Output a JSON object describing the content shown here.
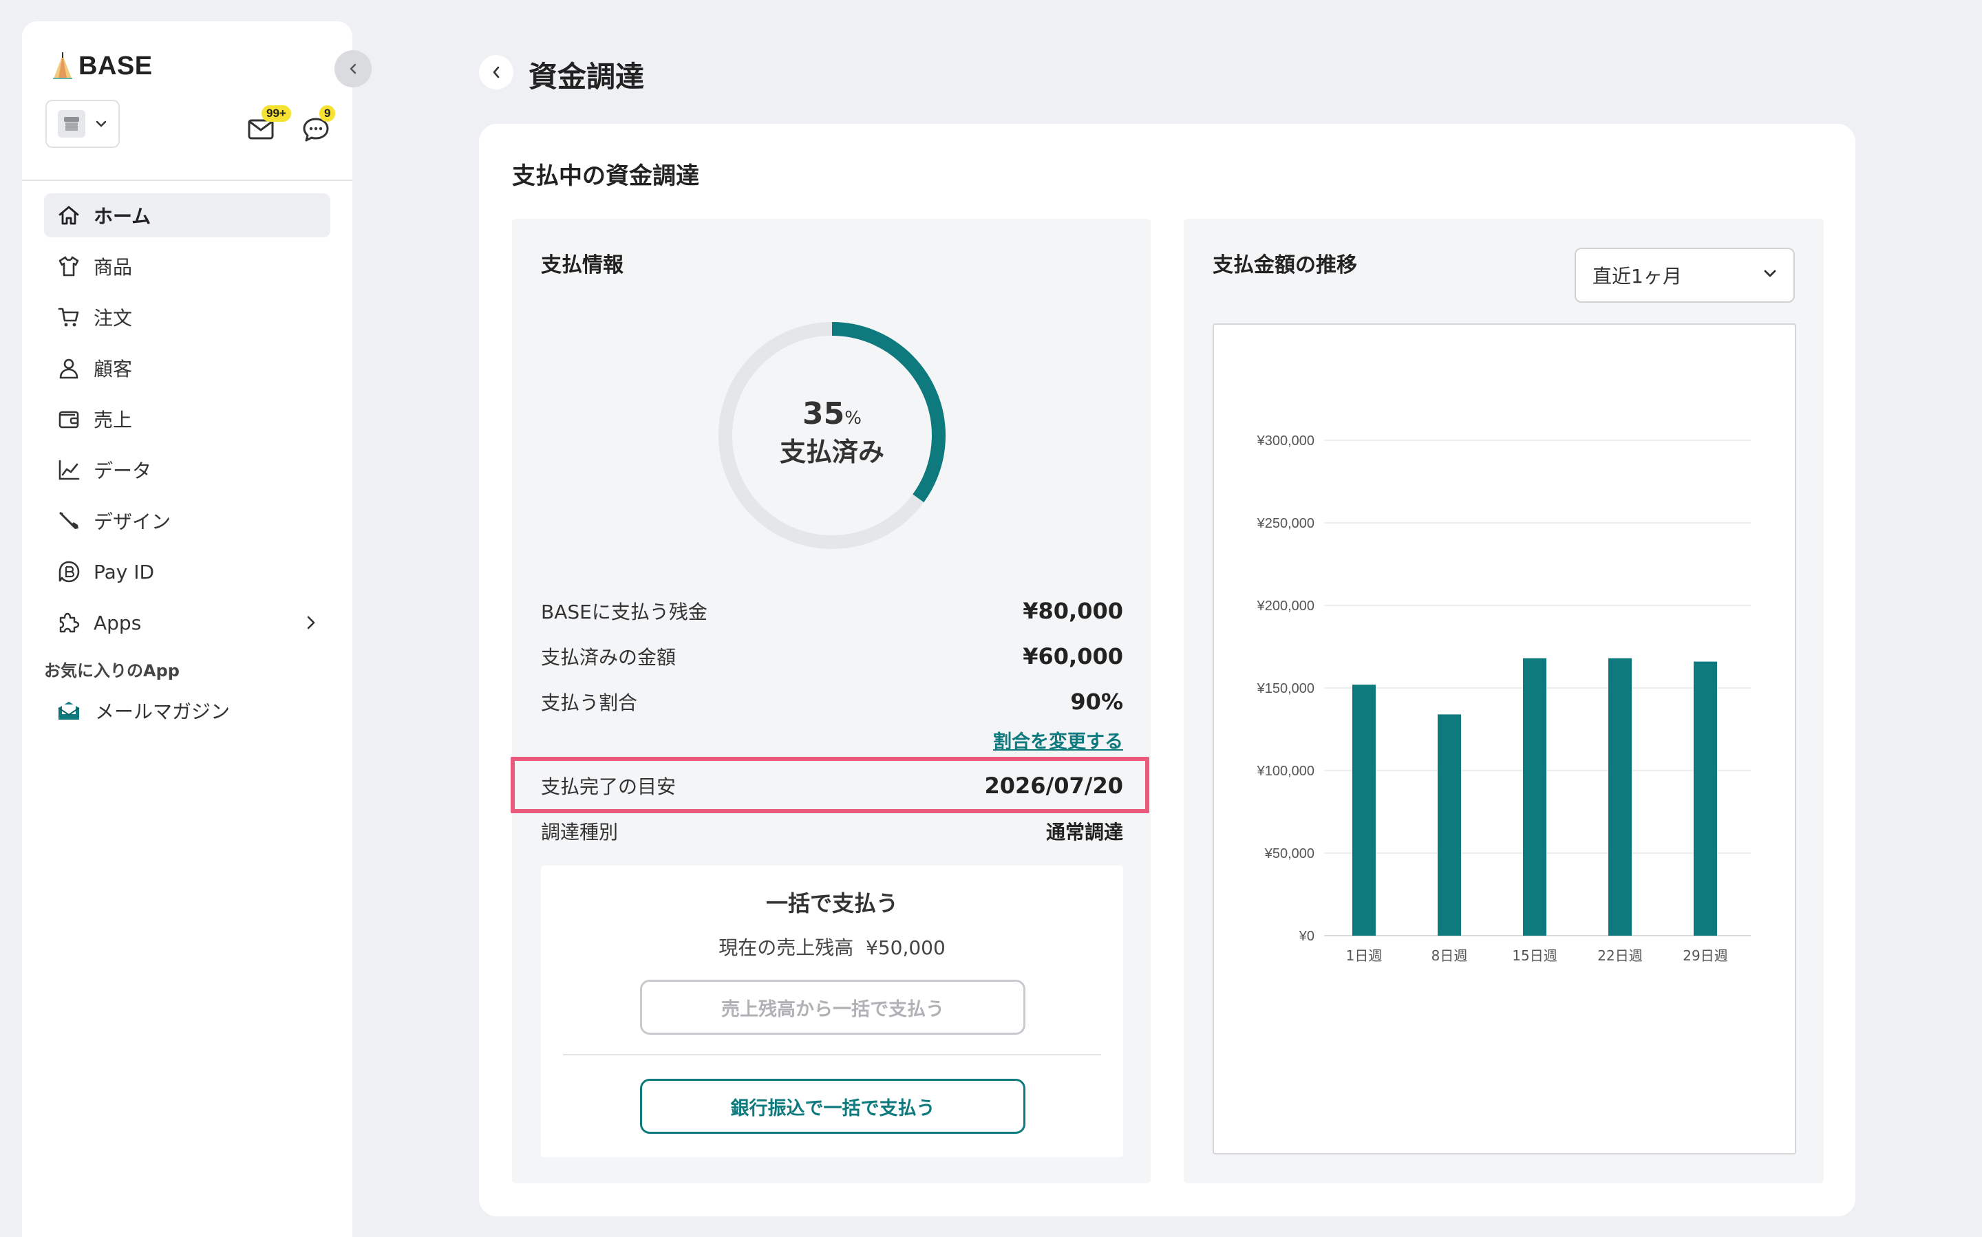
{
  "sidebar": {
    "brand": "BASE",
    "badges": {
      "mail": "99+",
      "chat": "9"
    },
    "items": [
      {
        "label": "ホーム",
        "icon": "home-icon"
      },
      {
        "label": "商品",
        "icon": "shirt-icon"
      },
      {
        "label": "注文",
        "icon": "cart-icon"
      },
      {
        "label": "顧客",
        "icon": "person-icon"
      },
      {
        "label": "売上",
        "icon": "wallet-icon"
      },
      {
        "label": "データ",
        "icon": "chart-line-icon"
      },
      {
        "label": "デザイン",
        "icon": "brush-icon"
      },
      {
        "label": "Pay ID",
        "icon": "pay-id-icon"
      },
      {
        "label": "Apps",
        "icon": "puzzle-icon"
      }
    ],
    "favorites_title": "お気に入りのApp",
    "favorites": [
      {
        "label": "メールマガジン",
        "icon": "mail-magazine-icon"
      }
    ]
  },
  "header": {
    "title": "資金調達"
  },
  "main": {
    "card_title": "支払中の資金調達",
    "payment_info": {
      "title": "支払情報",
      "progress_percent": 35,
      "progress_value": "35",
      "progress_unit": "%",
      "progress_label": "支払済み",
      "rows": [
        {
          "key": "BASEに支払う残金",
          "value": "¥80,000"
        },
        {
          "key": "支払済みの金額",
          "value": "¥60,000"
        },
        {
          "key": "支払う割合",
          "value": "90%"
        }
      ],
      "change_ratio_link": "割合を変更する",
      "completion_key": "支払完了の目安",
      "completion_value": "2026/07/20",
      "type_key": "調達種別",
      "type_value": "通常調達"
    },
    "lump_sum": {
      "title": "一括で支払う",
      "balance_label": "現在の売上残高",
      "balance_value": "¥50,000",
      "from_balance_button": "売上残高から一括で支払う",
      "bank_button": "銀行振込で一括で支払う"
    },
    "trend": {
      "title": "支払金額の推移",
      "range_selected": "直近1ヶ月"
    }
  },
  "colors": {
    "accent": "#0f7a7e",
    "highlight": "#ea5a7c",
    "badge": "#f5e233"
  },
  "chart_data": {
    "type": "bar",
    "categories": [
      "1日週",
      "8日週",
      "15日週",
      "22日週",
      "29日週"
    ],
    "values": [
      152000,
      134000,
      168000,
      168000,
      166000
    ],
    "ylim": [
      0,
      300000
    ],
    "yticks": [
      "¥0",
      "¥50,000",
      "¥100,000",
      "¥150,000",
      "¥200,000",
      "¥250,000",
      "¥300,000"
    ],
    "grid": true,
    "color": "#0f7a7e"
  }
}
